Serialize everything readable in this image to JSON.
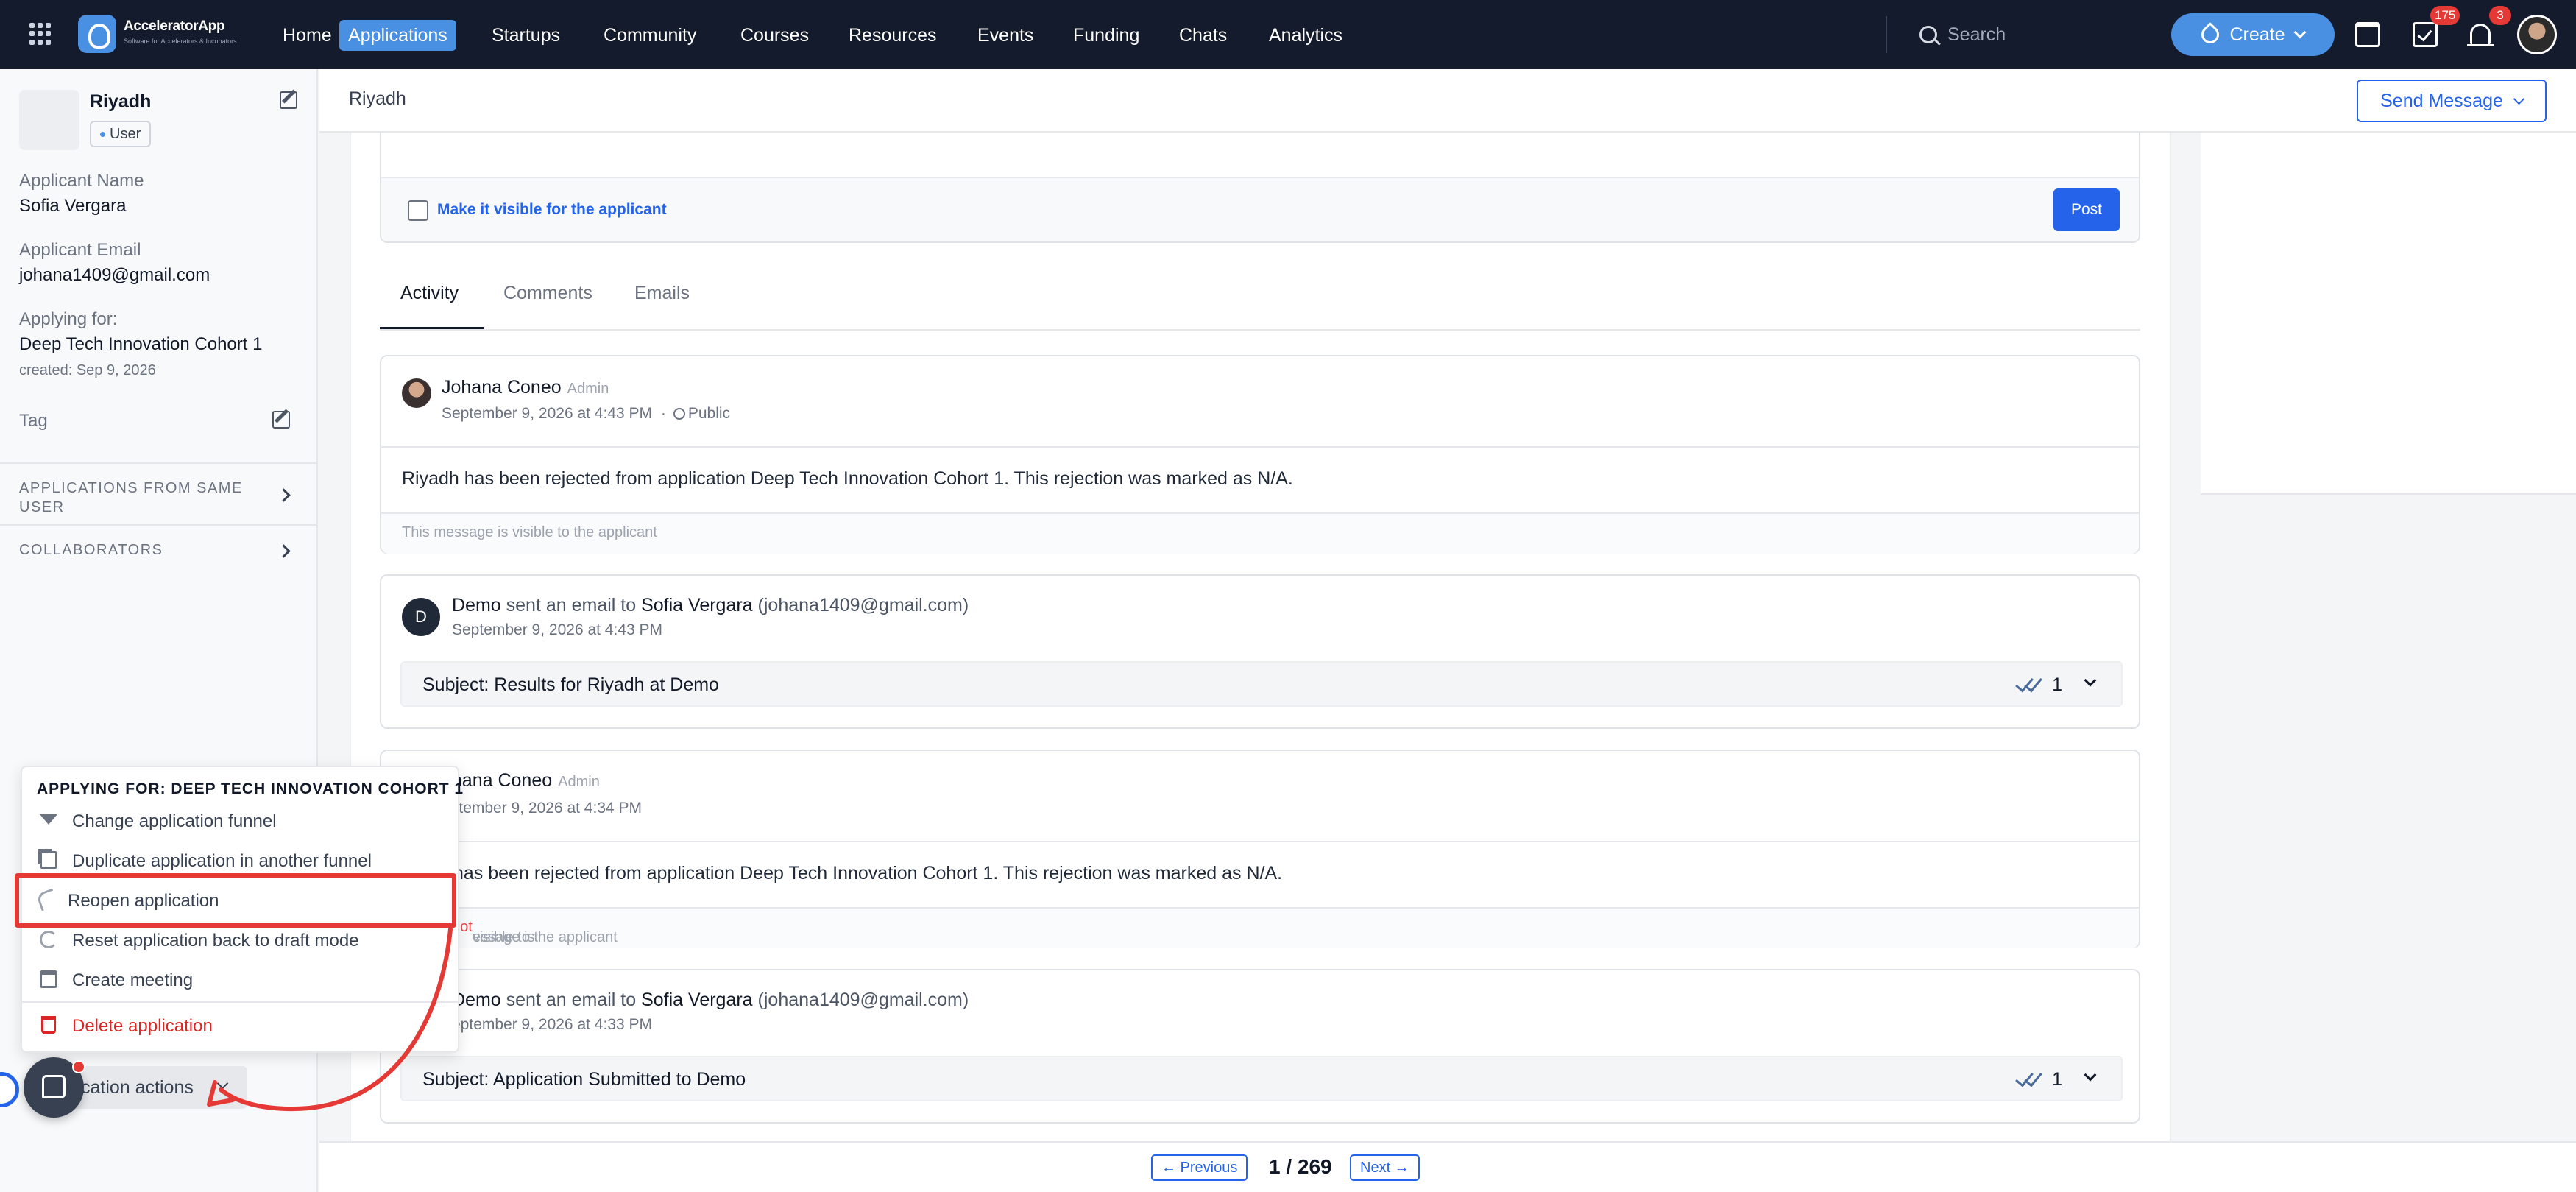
{
  "nav": {
    "logo": {
      "name": "AcceleratorApp",
      "tagline": "Software for Accelerators & Incubators"
    },
    "items": [
      {
        "label": "Home",
        "active": false
      },
      {
        "label": "Applications",
        "active": true
      },
      {
        "label": "Startups",
        "active": false
      },
      {
        "label": "Community",
        "active": false
      },
      {
        "label": "Courses",
        "active": false
      },
      {
        "label": "Resources",
        "active": false
      },
      {
        "label": "Events",
        "active": false
      },
      {
        "label": "Funding",
        "active": false
      },
      {
        "label": "Chats",
        "active": false
      },
      {
        "label": "Analytics",
        "active": false
      }
    ],
    "search_placeholder": "Search",
    "create_label": "Create",
    "tasks_badge": "175",
    "notifications_badge": "3",
    "accent_color": "#4a90e2",
    "bar_color": "#141b2d"
  },
  "sidebar": {
    "profile_name": "Riyadh",
    "role_pill": "User",
    "applicant_name_label": "Applicant Name",
    "applicant_name": "Sofia Vergara",
    "applicant_email_label": "Applicant Email",
    "applicant_email": "johana1409@gmail.com",
    "applying_for_label": "Applying for:",
    "applying_for": "Deep Tech Innovation Cohort 1",
    "created": "created: Sep 9, 2026",
    "tag_label": "Tag",
    "section_same_user_line1": "APPLICATIONS FROM SAME",
    "section_same_user_line2": "USER",
    "section_collaborators": "COLLABORATORS"
  },
  "header": {
    "breadcrumb": "Riyadh",
    "send_message_label": "Send Message"
  },
  "composer": {
    "visible_label": "Make it visible for the applicant",
    "post_label": "Post"
  },
  "tabs": [
    {
      "label": "Activity",
      "active": true
    },
    {
      "label": "Comments",
      "active": false
    },
    {
      "label": "Emails",
      "active": false
    }
  ],
  "activity": [
    {
      "author": "Johana Coneo",
      "role": "Admin",
      "time": "September 9, 2026 at 4:43 PM",
      "visibility": "Public",
      "body": "Riyadh has been rejected from application Deep Tech Innovation Cohort 1. This rejection was marked as N/A.",
      "footer": "This message is visible to the applicant"
    },
    {
      "sender": "Demo",
      "verb": "sent an email to",
      "recipient": "Sofia Vergara",
      "recipient_email": "(johana1409@gmail.com)",
      "time": "September 9, 2026 at 4:43 PM",
      "subject": "Subject: Results for Riyadh at Demo",
      "read_count": "1",
      "avatar_letter": "D"
    },
    {
      "author": "ohana Coneo",
      "role": "Admin",
      "time": "eptember 9, 2026 at 4:34 PM",
      "body": "has been rejected from application Deep Tech Innovation Cohort 1. This rejection was marked as N/A.",
      "footer_pre": "essage is",
      "footer_not": "not",
      "footer_post": "visible to the applicant"
    },
    {
      "sender": "Demo",
      "verb": "sent an email to",
      "recipient": "Sofia Vergara",
      "recipient_email": "(johana1409@gmail.com)",
      "time": "eptember 9, 2026 at 4:33 PM",
      "subject": "Subject: Application Submitted to Demo",
      "read_count": "1"
    }
  ],
  "pagination": {
    "previous_label": "← Previous",
    "next_label": "Next →",
    "count": "1 / 269"
  },
  "actions_menu": {
    "header": "APPLYING FOR: DEEP TECH INNOVATION COHORT 1",
    "items": [
      {
        "label": "Change application funnel",
        "icon": "funnel-icon"
      },
      {
        "label": "Duplicate application in another funnel",
        "icon": "duplicate-icon"
      },
      {
        "label": "Reopen application",
        "icon": "undo-icon"
      },
      {
        "label": "Reset application back to draft mode",
        "icon": "reset-icon"
      },
      {
        "label": "Create meeting",
        "icon": "calendar-icon"
      },
      {
        "label": "Delete application",
        "icon": "trash-icon"
      }
    ],
    "button_label": "cation actions",
    "highlight_color": "#e53935"
  }
}
